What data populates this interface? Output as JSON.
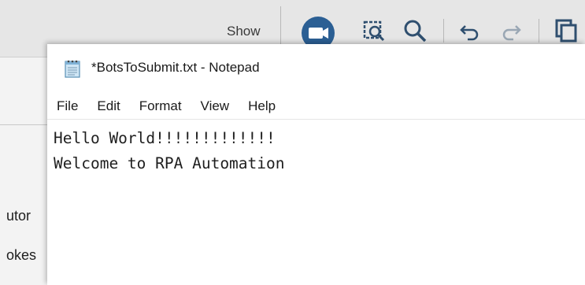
{
  "background_app": {
    "toolbar": {
      "show_label": "Show",
      "icons": [
        "camera-icon",
        "zoom-region-icon",
        "search-icon",
        "undo-icon",
        "redo-icon",
        "copy-icon"
      ]
    },
    "left_panel_text": [
      "utor",
      "okes"
    ]
  },
  "notepad": {
    "title": "*BotsToSubmit.txt - Notepad",
    "menu": [
      "File",
      "Edit",
      "Format",
      "View",
      "Help"
    ],
    "content_lines": [
      "Hello World!!!!!!!!!!!!!",
      "Welcome to RPA Automation"
    ]
  },
  "colors": {
    "toolbar_bg": "#e6e6e6",
    "camera_button_blue": "#2b6cb0",
    "icon_gray": "#2f4f6f"
  }
}
